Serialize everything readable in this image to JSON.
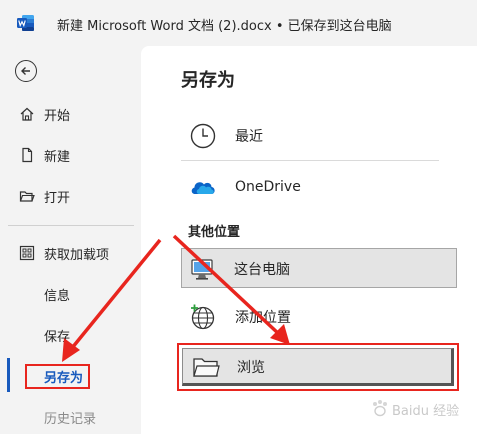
{
  "titlebar": {
    "doc_title": "新建 Microsoft Word 文档 (2).docx • 已保存到这台电脑",
    "logo_icon": "word-logo-icon"
  },
  "sidebar": {
    "back_icon": "back-arrow-icon",
    "items": [
      {
        "label": "开始",
        "icon": "home-icon"
      },
      {
        "label": "新建",
        "icon": "new-document-icon"
      },
      {
        "label": "打开",
        "icon": "open-folder-icon"
      },
      {
        "label": "获取加载项",
        "icon": "addins-grid-icon"
      },
      {
        "label": "信息"
      },
      {
        "label": "保存"
      },
      {
        "label": "另存为"
      },
      {
        "label": "历史记录"
      }
    ],
    "active_item": "另存为"
  },
  "main": {
    "title": "另存为",
    "recent": {
      "label": "最近",
      "icon": "clock-icon"
    },
    "onedrive": {
      "label": "OneDrive",
      "icon": "onedrive-cloud-icon"
    },
    "other_heading": "其他位置",
    "this_pc": {
      "label": "这台电脑",
      "icon": "computer-icon"
    },
    "add_location": {
      "label": "添加位置",
      "icon": "globe-add-icon"
    },
    "browse": {
      "label": "浏览",
      "icon": "folder-icon"
    }
  },
  "annotations": {
    "arrow_color": "#e8251e",
    "highlight_color": "#e8251e"
  },
  "watermark": {
    "text": "Baidu 经验",
    "icon": "baidu-paw-icon"
  },
  "colors": {
    "accent": "#185abd",
    "word_blue": "#185abd",
    "background": "#f3f3f3",
    "panel": "#ffffff"
  }
}
